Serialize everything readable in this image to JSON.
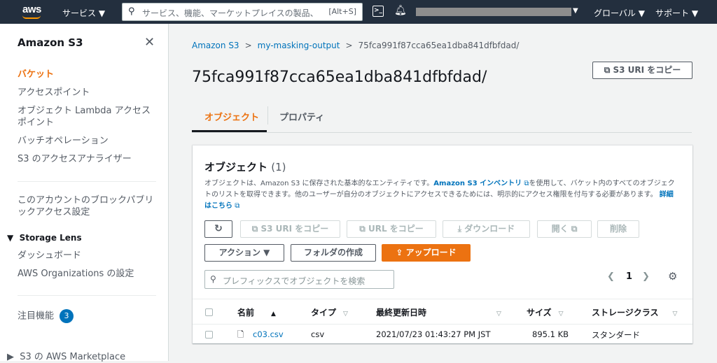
{
  "topnav": {
    "logo": "aws",
    "services_label": "サービス ▼",
    "search_placeholder": "サービス、機能、マーケットプレイスの製品、",
    "search_shortcut": "[Alt+S]",
    "region_label": "グローバル ▼",
    "support_label": "サポート ▼"
  },
  "sidebar": {
    "title": "Amazon S3",
    "items": [
      {
        "label": "バケット"
      },
      {
        "label": "アクセスポイント"
      },
      {
        "label": "オブジェクト Lambda アクセスポイント"
      },
      {
        "label": "バッチオペレーション"
      },
      {
        "label": "S3 のアクセスアナライザー"
      },
      {
        "label": "このアカウントのブロックパブリックアクセス設定"
      },
      {
        "label": "ダッシュボード"
      },
      {
        "label": "AWS Organizations の設定"
      },
      {
        "label": "注目機能"
      },
      {
        "label": "S3 の AWS Marketplace"
      }
    ],
    "storage_lens": "Storage Lens",
    "featured_count": "3"
  },
  "breadcrumb": [
    "Amazon S3",
    "my-masking-output",
    "75fca991f87cca65ea1dba841dfbfdad/"
  ],
  "page_title": "75fca991f87cca65ea1dba841dfbfdad/",
  "copy_uri_button": "S3 URI をコピー",
  "tabs": [
    {
      "label": "オブジェクト"
    },
    {
      "label": "プロパティ"
    }
  ],
  "objects_panel": {
    "title": "オブジェクト",
    "count": "(1)",
    "desc_1": "オブジェクトは、Amazon S3 に保存された基本的なエンティティです。",
    "desc_link1": "Amazon S3 インベントリ",
    "desc_2": "を使用して、バケット内のすべてのオブジェクトのリストを取得できます。他のユーザーが自分のオブジェクトにアクセスできるためには、明示的にアクセス権限を付与する必要があります。",
    "desc_link2": "詳細はこちら",
    "buttons": {
      "refresh": "↻",
      "copy_uri": "S3 URI をコピー",
      "copy_url": "URL をコピー",
      "download": "ダウンロード",
      "open": "開く",
      "delete": "削除",
      "actions": "アクション ▼",
      "create_folder": "フォルダの作成",
      "upload": "アップロード"
    },
    "filter_placeholder": "プレフィックスでオブジェクトを検索",
    "page": "1",
    "columns": [
      "名前",
      "タイプ",
      "最終更新日時",
      "サイズ",
      "ストレージクラス"
    ],
    "rows": [
      {
        "name": "c03.csv",
        "type": "csv",
        "modified": "2021/07/23 01:43:27 PM JST",
        "size": "895.1 KB",
        "storage_class": "スタンダード"
      }
    ]
  },
  "colors": {
    "accent": "#ec7211",
    "link": "#0073bb",
    "nav_bg": "#232f3e"
  }
}
